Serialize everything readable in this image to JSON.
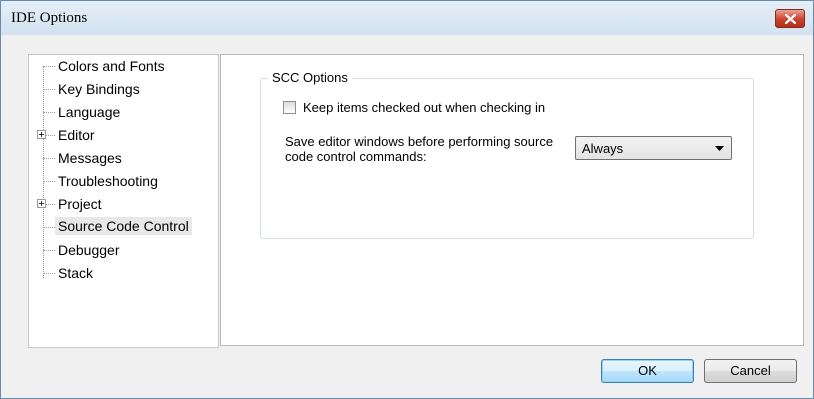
{
  "window": {
    "title": "IDE Options"
  },
  "tree": {
    "items": [
      {
        "label": "Colors and Fonts",
        "expandable": false
      },
      {
        "label": "Key Bindings",
        "expandable": false
      },
      {
        "label": "Language",
        "expandable": false
      },
      {
        "label": "Editor",
        "expandable": true
      },
      {
        "label": "Messages",
        "expandable": false
      },
      {
        "label": "Troubleshooting",
        "expandable": false
      },
      {
        "label": "Project",
        "expandable": true
      },
      {
        "label": "Source Code Control",
        "expandable": false,
        "selected": true
      },
      {
        "label": "Debugger",
        "expandable": false
      },
      {
        "label": "Stack",
        "expandable": false
      }
    ]
  },
  "scc": {
    "group_title": "SCC Options",
    "keep_checked_out_label": "Keep items checked out when checking in",
    "keep_checked_out_checked": false,
    "save_windows_label": "Save editor windows before performing source code control commands:",
    "save_windows_value": "Always"
  },
  "buttons": {
    "ok": "OK",
    "cancel": "Cancel"
  },
  "colors": {
    "title_bar": "#d3e2f1",
    "close_button": "#c8432c",
    "selected_item_bg": "#e8e8e8",
    "default_button_border": "#3c7fb1"
  },
  "icons": {
    "close": "close-icon",
    "expand": "plus-box-icon",
    "dropdown": "chevron-down-icon"
  }
}
